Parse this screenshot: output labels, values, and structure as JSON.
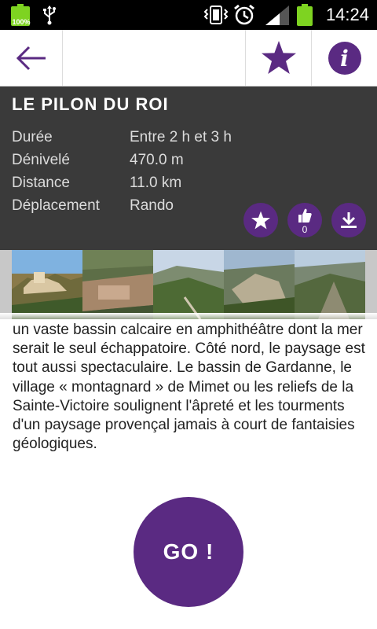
{
  "status_bar": {
    "battery_left_label": "100%",
    "time": "14:24"
  },
  "toolbar": {
    "back_icon": "arrow-left-icon",
    "favorite_icon": "star-icon",
    "info_icon": "info-icon",
    "info_glyph": "i"
  },
  "trail": {
    "title": "LE PILON DU ROI",
    "details": [
      {
        "label": "Durée",
        "value": "Entre 2 h et 3 h"
      },
      {
        "label": "Dénivelé",
        "value": "470.0 m"
      },
      {
        "label": "Distance",
        "value": "11.0 km"
      },
      {
        "label": "Déplacement",
        "value": "Rando"
      }
    ],
    "like_count": "0"
  },
  "description": "un vaste bassin calcaire en amphithéâtre dont la mer serait le seul échappatoire. Côté nord, le paysage est tout aussi spectaculaire. Le bassin de Gardanne, le village « montagnard » de Mimet ou les reliefs de la Sainte-Victoire soulignent l'âpreté et les tourments d'un paysage provençal jamais à court de fantaisies géologiques.",
  "go_label": "GO !",
  "colors": {
    "accent": "#5a2a82",
    "panel": "#3a3a3a",
    "status_green": "#7ed321"
  }
}
